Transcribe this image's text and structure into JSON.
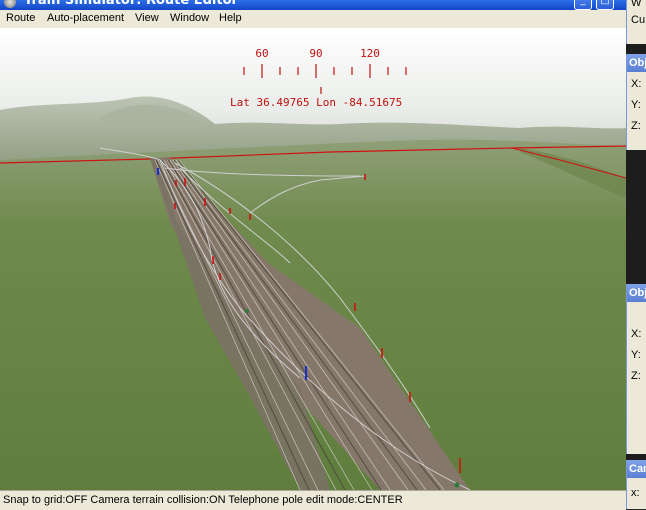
{
  "window": {
    "title": "Train Simulator: Route Editor",
    "minimize": "_",
    "maximize": "□"
  },
  "menu": {
    "items": [
      "Route",
      "Auto-placement",
      "View",
      "Window",
      "Help"
    ]
  },
  "compass": {
    "labels": [
      "60",
      "90",
      "120"
    ],
    "readout": "Lat 36.49765 Lon -84.51675"
  },
  "status": {
    "text": "Snap to grid:OFF Camera terrain collision:ON Telephone pole edit mode:CENTER"
  },
  "panels": {
    "top": {
      "row1": "W",
      "row2": "Cu"
    },
    "objects1": {
      "title": "Obj",
      "x": "X:",
      "y": "Y:",
      "z": "Z:"
    },
    "objects2": {
      "title": "Obj",
      "x": "X:",
      "y": "Y:",
      "z": "Z:"
    },
    "camera": {
      "title": "Cam",
      "x": "x:"
    }
  },
  "colors": {
    "accent": "#c01010",
    "sky": "#d8dcd8",
    "grass": "#6f8a4c",
    "track": "#8a7f6d"
  }
}
